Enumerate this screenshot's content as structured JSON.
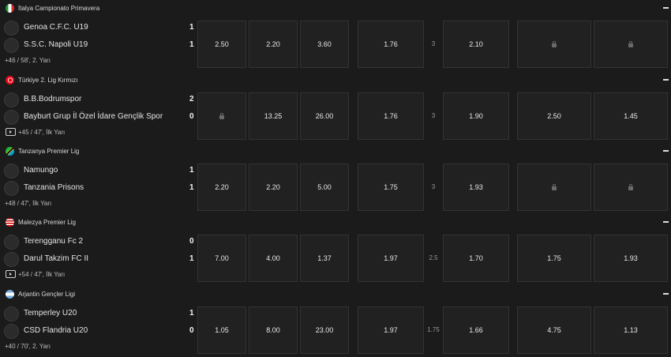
{
  "matches": [
    {
      "league": "İtalya Campionato Primavera",
      "flag": "italy",
      "team1": "Genoa C.F.C. U19",
      "score1": "1",
      "team2": "S.S.C. Napoli U19",
      "score2": "1",
      "has_stream": false,
      "info": "+46 / 58', 2. Yarı",
      "odds": {
        "home": "2.50",
        "draw": "2.20",
        "away": "3.60",
        "over": "1.76",
        "line": "3",
        "under": "2.10",
        "yes": "",
        "no": ""
      },
      "locked": {
        "home": false,
        "yes": true,
        "no": true
      }
    },
    {
      "league": "Türkiye 2. Lig Kırmızı",
      "flag": "turkey",
      "team1": "B.B.Bodrumspor",
      "score1": "2",
      "team2": "Bayburt Grup İl Özel İdare Gençlik Spor",
      "score2": "0",
      "has_stream": true,
      "info": "+45 / 47', İlk Yarı",
      "odds": {
        "home": "",
        "draw": "13.25",
        "away": "26.00",
        "over": "1.76",
        "line": "3",
        "under": "1.90",
        "yes": "2.50",
        "no": "1.45"
      },
      "locked": {
        "home": true,
        "yes": false,
        "no": false
      }
    },
    {
      "league": "Tanzanya Premier Lig",
      "flag": "tanzania",
      "team1": "Namungo",
      "score1": "1",
      "team2": "Tanzania Prisons",
      "score2": "1",
      "has_stream": false,
      "info": "+48 / 47', İlk Yarı",
      "odds": {
        "home": "2.20",
        "draw": "2.20",
        "away": "5.00",
        "over": "1.75",
        "line": "3",
        "under": "1.93",
        "yes": "",
        "no": ""
      },
      "locked": {
        "home": false,
        "yes": true,
        "no": true
      }
    },
    {
      "league": "Malezya Premier Lig",
      "flag": "malaysia",
      "team1": "Terengganu Fc 2",
      "score1": "0",
      "team2": "Darul Takzim FC II",
      "score2": "1",
      "has_stream": true,
      "info": "+54 / 47', İlk Yarı",
      "odds": {
        "home": "7.00",
        "draw": "4.00",
        "away": "1.37",
        "over": "1.97",
        "line": "2.5",
        "under": "1.70",
        "yes": "1.75",
        "no": "1.93"
      },
      "locked": {
        "home": false,
        "yes": false,
        "no": false
      }
    },
    {
      "league": "Arjantin Gençler Ligi",
      "flag": "argentina",
      "team1": "Temperley U20",
      "score1": "1",
      "team2": "CSD Flandria U20",
      "score2": "0",
      "has_stream": false,
      "info": "+40 / 70', 2. Yarı",
      "odds": {
        "home": "1.05",
        "draw": "8.00",
        "away": "23.00",
        "over": "1.97",
        "line": "1.75",
        "under": "1.66",
        "yes": "4.75",
        "no": "1.13"
      },
      "locked": {
        "home": false,
        "yes": false,
        "no": false
      }
    }
  ]
}
